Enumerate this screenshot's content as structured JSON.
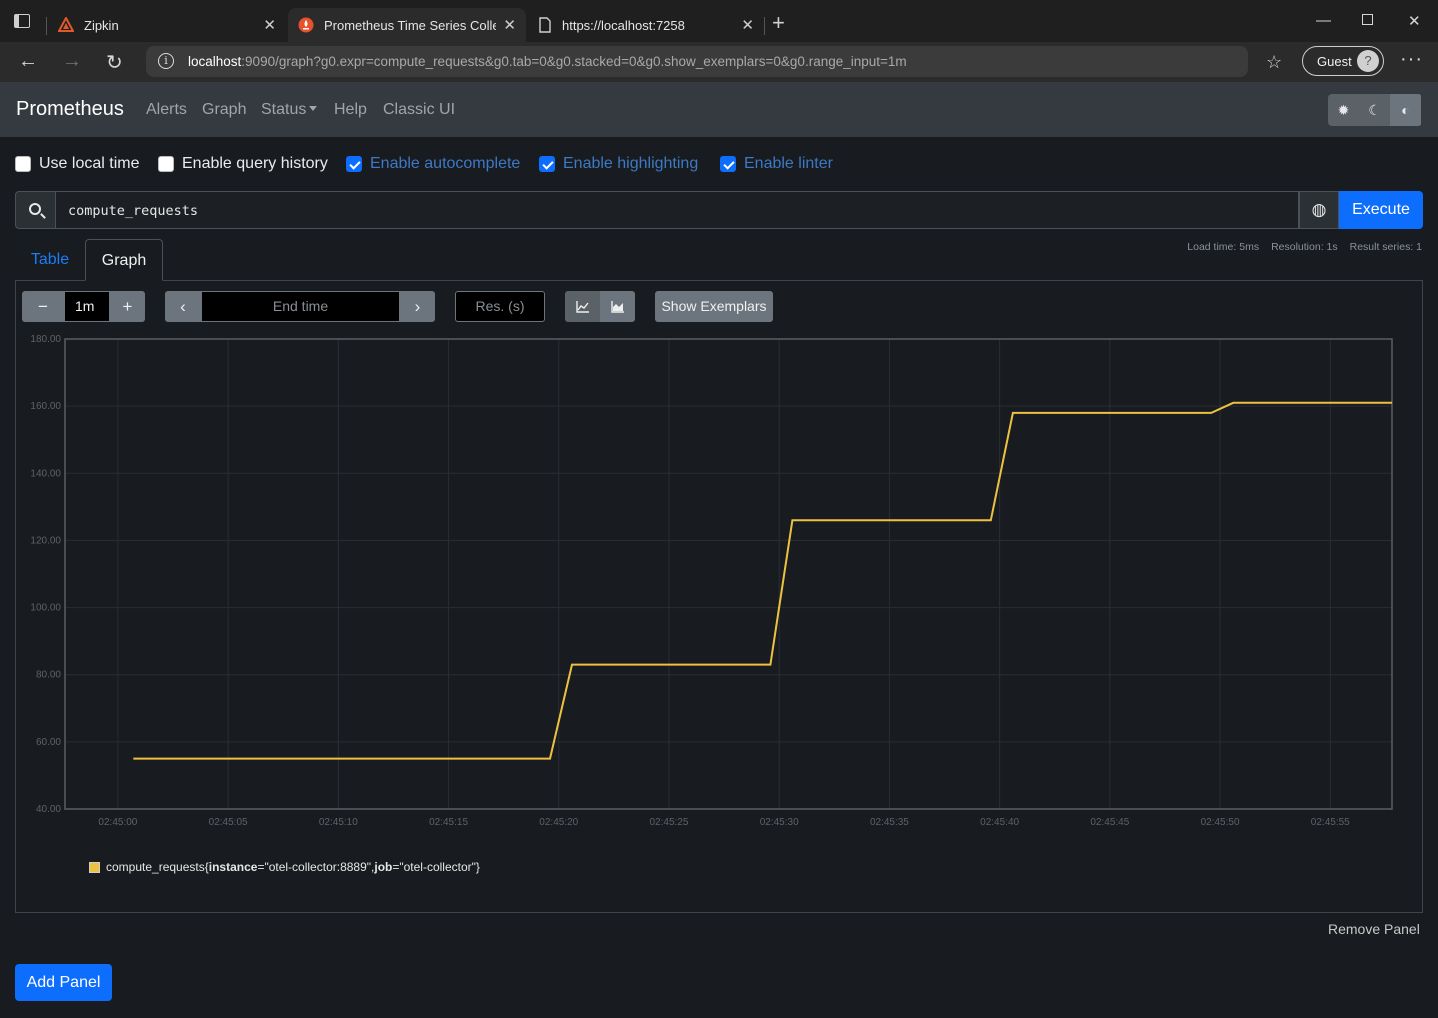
{
  "browser": {
    "tabs": [
      {
        "title": "Zipkin",
        "active": false
      },
      {
        "title": "Prometheus Time Series Collectio",
        "active": true
      },
      {
        "title": "https://localhost:7258",
        "active": false
      }
    ],
    "url_host": "localhost",
    "url_rest": ":9090/graph?g0.expr=compute_requests&g0.tab=0&g0.stacked=0&g0.show_exemplars=0&g0.range_input=1m",
    "profile_label": "Guest"
  },
  "navbar": {
    "brand": "Prometheus",
    "links": [
      "Alerts",
      "Graph",
      "Status",
      "Help",
      "Classic UI"
    ]
  },
  "options": [
    {
      "label": "Use local time",
      "checked": false
    },
    {
      "label": "Enable query history",
      "checked": false
    },
    {
      "label": "Enable autocomplete",
      "checked": true
    },
    {
      "label": "Enable highlighting",
      "checked": true
    },
    {
      "label": "Enable linter",
      "checked": true
    }
  ],
  "query": {
    "expression": "compute_requests",
    "execute_label": "Execute"
  },
  "panel_tabs": {
    "table": "Table",
    "graph": "Graph"
  },
  "stats": {
    "load_time": "Load time: 5ms",
    "resolution": "Resolution: 1s",
    "result_series": "Result series: 1"
  },
  "controls": {
    "range_value": "1m",
    "end_time_placeholder": "End time",
    "resolution_placeholder": "Res. (s)",
    "exemplars_label": "Show Exemplars"
  },
  "chart_data": {
    "type": "line",
    "y_ticks": [
      "40.00",
      "60.00",
      "80.00",
      "100.00",
      "120.00",
      "140.00",
      "160.00",
      "180.00"
    ],
    "ylim": [
      40,
      180
    ],
    "x_ticks": [
      "02:45:00",
      "02:45:05",
      "02:45:10",
      "02:45:15",
      "02:45:20",
      "02:45:25",
      "02:45:30",
      "02:45:35",
      "02:45:40",
      "02:45:45",
      "02:45:50",
      "02:45:55"
    ],
    "x_range_seconds": [
      -2.4,
      57.8
    ],
    "line_color": "#edc240",
    "series": [
      {
        "name": "compute_requests{instance=\"otel-collector:8889\", job=\"otel-collector\"}",
        "points": [
          [
            0.7,
            55
          ],
          [
            19.6,
            55
          ],
          [
            20.6,
            83
          ],
          [
            29.6,
            83
          ],
          [
            30.6,
            126
          ],
          [
            39.6,
            126
          ],
          [
            40.6,
            158
          ],
          [
            49.6,
            158
          ],
          [
            50.6,
            161
          ],
          [
            57.8,
            161
          ]
        ]
      }
    ]
  },
  "legend": {
    "metric": "compute_requests",
    "labels_prefix": "{",
    "label1_key": "instance",
    "label1_val": "=\"otel-collector:8889\", ",
    "label2_key": "job",
    "label2_val": "=\"otel-collector\"}"
  },
  "footer": {
    "remove_panel": "Remove Panel",
    "add_panel": "Add Panel"
  }
}
